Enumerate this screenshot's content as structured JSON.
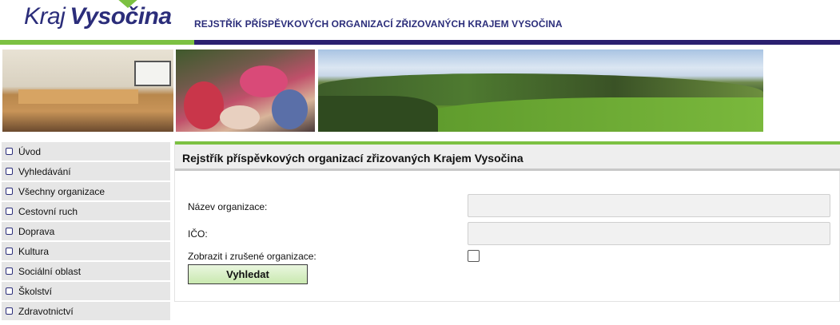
{
  "logo": {
    "word1": "Kraj",
    "word2": "Vysočina"
  },
  "header": {
    "title": "REJSTŘÍK PŘÍSPĚVKOVÝCH ORGANIZACÍ ZŘIZOVANÝCH KRAJEM VYSOČINA"
  },
  "sidebar": {
    "items": [
      {
        "label": "Úvod"
      },
      {
        "label": "Vyhledávání"
      },
      {
        "label": "Všechny organizace"
      },
      {
        "label": "Cestovní ruch"
      },
      {
        "label": "Doprava"
      },
      {
        "label": "Kultura"
      },
      {
        "label": "Sociální oblast"
      },
      {
        "label": "Školství"
      },
      {
        "label": "Zdravotnictví"
      }
    ]
  },
  "main": {
    "title": "Rejstřík příspěvkových organizací zřizovaných Krajem Vysočina",
    "form": {
      "name_label": "Název organizace:",
      "name_value": "",
      "ico_label": "IČO:",
      "ico_value": "",
      "show_cancelled_label": "Zobrazit i zrušené organizace:",
      "show_cancelled_checked": false,
      "search_button": "Vyhledat"
    }
  },
  "colors": {
    "brand_navy": "#2b2d7a",
    "brand_green": "#7cc142",
    "stripe_navy": "#2b2070",
    "button_green": "#c9e8b0"
  }
}
